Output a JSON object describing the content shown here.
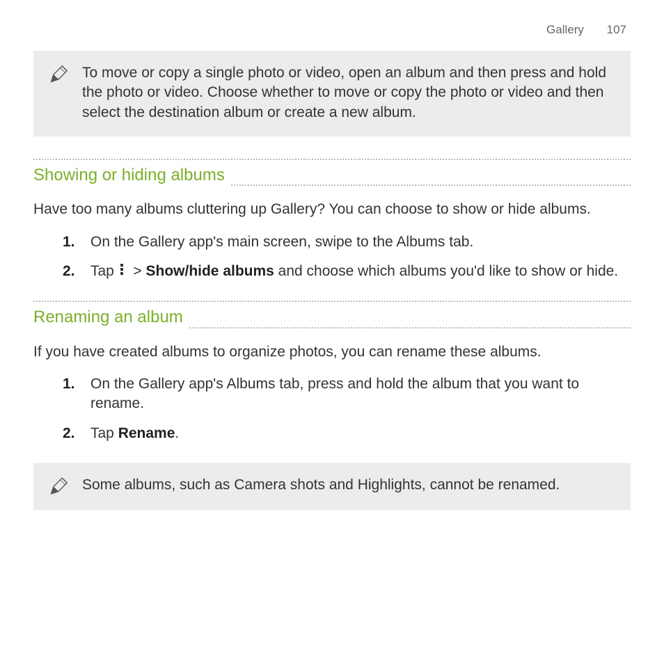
{
  "header": {
    "section": "Gallery",
    "page": "107"
  },
  "note1": "To move or copy a single photo or video, open an album and then press and hold the photo or video. Choose whether to move or copy the photo or video and then select the destination album or create a new album.",
  "s1": {
    "title": "Showing or hiding albums",
    "intro": "Have too many albums cluttering up Gallery? You can choose to show or hide albums.",
    "steps": [
      {
        "n": "1.",
        "text": "On the Gallery app's main screen, swipe to the Albums tab."
      },
      {
        "n": "2.",
        "pre": "Tap ",
        "bold": "Show/hide albums",
        "post": " and choose which albums you'd like to show or hide."
      }
    ]
  },
  "s2": {
    "title": "Renaming an album",
    "intro": "If you have created albums to organize photos, you can rename these albums.",
    "steps": [
      {
        "n": "1.",
        "text": "On the Gallery app's Albums tab, press and hold the album that you want to rename."
      },
      {
        "n": "2.",
        "pre": "Tap ",
        "bold": "Rename",
        "post": "."
      }
    ]
  },
  "note2": "Some albums, such as Camera shots and Highlights, cannot be renamed."
}
